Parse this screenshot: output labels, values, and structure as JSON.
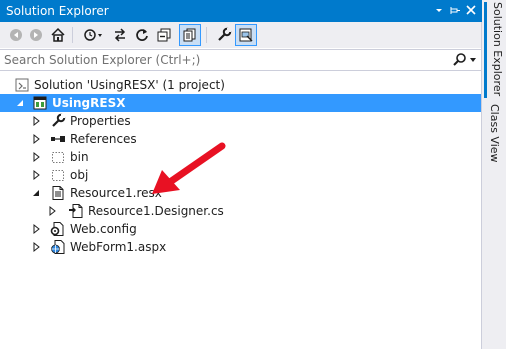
{
  "window": {
    "title": "Solution Explorer"
  },
  "titlebar_icons": [
    "dropdown-icon",
    "pin-icon",
    "close-icon"
  ],
  "toolbar": {
    "buttons": [
      "back-icon",
      "forward-icon",
      "home-icon",
      "history-icon",
      "sync-icon",
      "refresh-icon",
      "collapse-all-icon",
      "show-all-files-icon",
      "properties-icon",
      "preview-icon"
    ]
  },
  "search": {
    "placeholder": "Search Solution Explorer (Ctrl+;)"
  },
  "tree": {
    "solution": "Solution 'UsingRESX' (1 project)",
    "project": "UsingRESX",
    "properties": "Properties",
    "references": "References",
    "bin": "bin",
    "obj": "obj",
    "resource": "Resource1.resx",
    "designer": "Resource1.Designer.cs",
    "webconfig": "Web.config",
    "webform": "WebForm1.aspx"
  },
  "side_tabs": {
    "solution_explorer": "Solution Explorer",
    "class_view": "Class View"
  },
  "colors": {
    "accent": "#007acc",
    "selection": "#3399ff",
    "arrow": "#e81123"
  }
}
